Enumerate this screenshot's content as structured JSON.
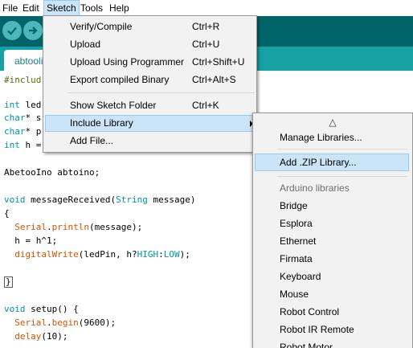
{
  "menubar": {
    "items": [
      {
        "label": "File"
      },
      {
        "label": "Edit"
      },
      {
        "label": "Sketch",
        "active": true
      },
      {
        "label": "Tools"
      },
      {
        "label": "Help"
      }
    ]
  },
  "toolbar": {
    "verify_icon": "checkmark-icon",
    "upload_icon": "right-arrow-icon",
    "colors": {
      "bar": "#006468",
      "button": "#4db7bb",
      "tab_strip": "#17a1a5"
    }
  },
  "tabs": [
    {
      "label": "abtooli"
    }
  ],
  "editor": {
    "lines": {
      "l1": "#includ",
      "l2a": "int",
      "l2b": " led",
      "l3a": "char",
      "l3b": "* s",
      "l4a": "char",
      "l4b": "* p",
      "l5a": "int",
      "l5b": " h =",
      "l6": "AbetooIno abtoino;",
      "l7a": "void",
      "l7b": " messageReceived(",
      "l7c": "String",
      "l7d": " message)",
      "l8": "{",
      "l9a": "Serial",
      "l9b": ".",
      "l9c": "println",
      "l9d": "(message);",
      "l10": "  h = h^1;",
      "l11a": "digitalWrite",
      "l11b": "(ledPin, h?",
      "l11c": "HIGH",
      "l11d": ":",
      "l11e": "LOW",
      "l11f": ");",
      "l12": "}",
      "l13a": "void",
      "l13b": " setup() {",
      "l14a": "Serial",
      "l14b": ".",
      "l14c": "begin",
      "l14d": "(9600);",
      "l15a": "delay",
      "l15b": "(10);"
    }
  },
  "sketch_menu": {
    "items": [
      {
        "label": "Verify/Compile",
        "shortcut": "Ctrl+R"
      },
      {
        "label": "Upload",
        "shortcut": "Ctrl+U"
      },
      {
        "label": "Upload Using Programmer",
        "shortcut": "Ctrl+Shift+U"
      },
      {
        "label": "Export compiled Binary",
        "shortcut": "Ctrl+Alt+S"
      },
      {
        "label": "Show Sketch Folder",
        "shortcut": "Ctrl+K"
      },
      {
        "label": "Include Library",
        "shortcut": "",
        "highlighted": true,
        "submenu": true
      },
      {
        "label": "Add File...",
        "shortcut": ""
      }
    ]
  },
  "include_library_menu": {
    "scroll_up": "△",
    "items": [
      {
        "label": "Manage Libraries..."
      },
      {
        "label": "Add .ZIP Library...",
        "highlighted": true
      },
      {
        "label": "Arduino libraries",
        "header": true
      },
      {
        "label": "Bridge"
      },
      {
        "label": "Esplora"
      },
      {
        "label": "Ethernet"
      },
      {
        "label": "Firmata"
      },
      {
        "label": "Keyboard"
      },
      {
        "label": "Mouse"
      },
      {
        "label": "Robot Control"
      },
      {
        "label": "Robot IR Remote"
      },
      {
        "label": "Robot Motor"
      }
    ]
  }
}
